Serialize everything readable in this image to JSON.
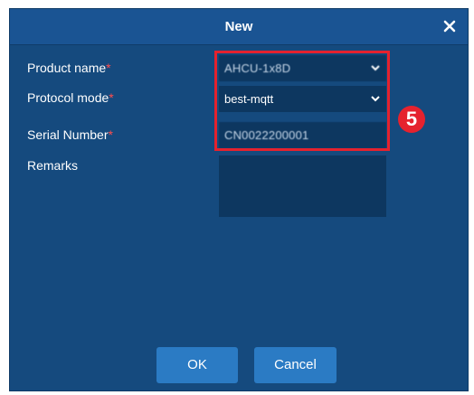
{
  "dialog": {
    "title": "New",
    "close_icon": "close-icon"
  },
  "form": {
    "product_name": {
      "label": "Product name",
      "required_mark": "*",
      "value": "AHCU-1x8D"
    },
    "protocol_mode": {
      "label": "Protocol mode",
      "required_mark": "*",
      "value": "best-mqtt"
    },
    "serial_number": {
      "label": "Serial Number",
      "required_mark": "*",
      "value": "CN0022200001"
    },
    "remarks": {
      "label": "Remarks",
      "value": ""
    }
  },
  "annotation": {
    "step_number": "5",
    "highlight_color": "#e5222e"
  },
  "buttons": {
    "ok_label": "OK",
    "cancel_label": "Cancel"
  },
  "colors": {
    "dialog_bg": "#154a7e",
    "input_bg": "#0d3760",
    "button_bg": "#2b7bc4",
    "required": "#ff4d4d"
  }
}
